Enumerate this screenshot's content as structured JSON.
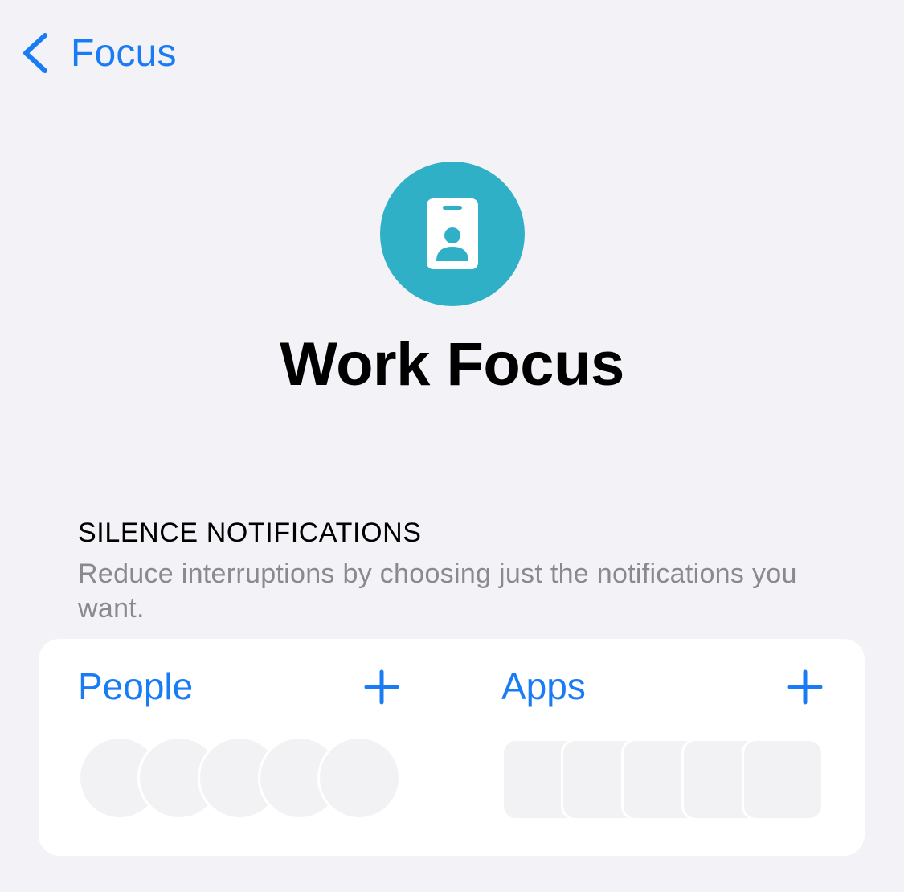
{
  "nav": {
    "back_label": "Focus",
    "back_icon": "chevron-left-icon",
    "tint_color": "#1a7cf5"
  },
  "focus": {
    "icon": "id-badge-icon",
    "icon_color": "#30b0c7",
    "title": "Work Focus"
  },
  "silence_notifications": {
    "header": "SILENCE NOTIFICATIONS",
    "description": "Reduce interruptions by choosing just the notifications you want.",
    "people": {
      "label": "People",
      "add_icon": "plus-icon",
      "placeholder_count": 5
    },
    "apps": {
      "label": "Apps",
      "add_icon": "plus-icon",
      "placeholder_count": 5
    }
  }
}
